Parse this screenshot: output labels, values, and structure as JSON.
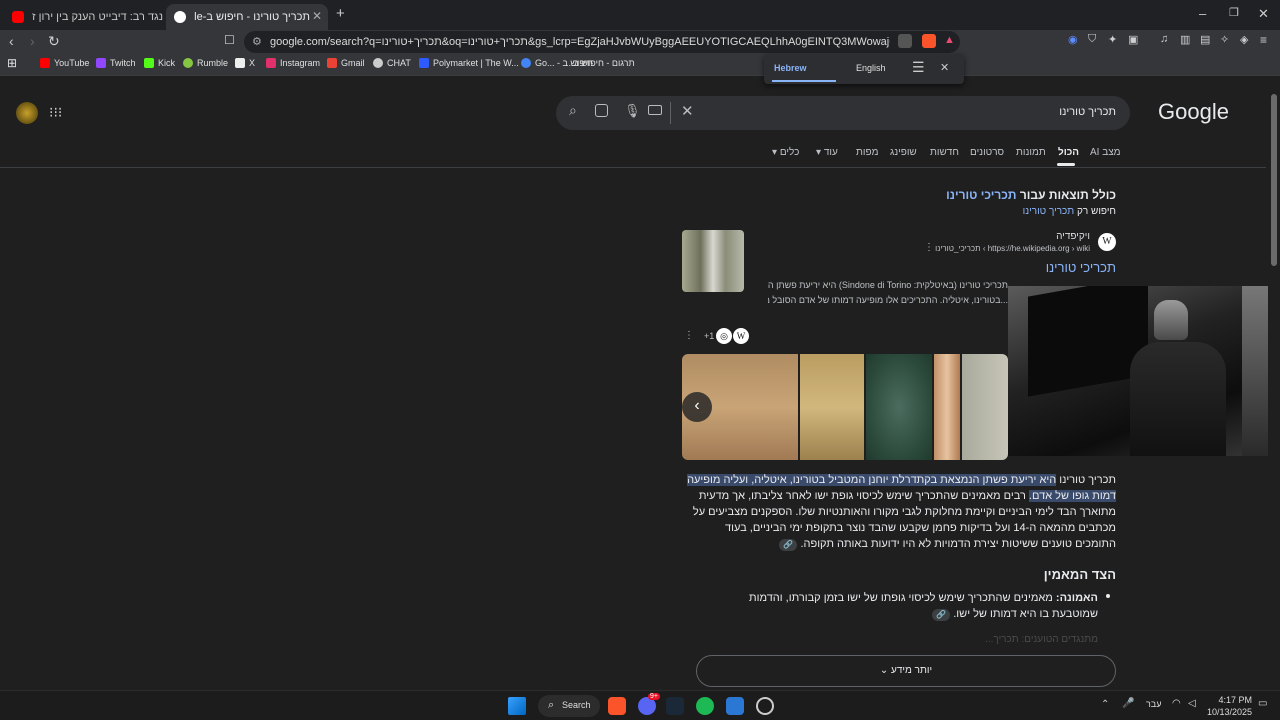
{
  "browser": {
    "tabs": [
      {
        "title": "אתאיסט נגד רב: דיבייט הענק בין ירון ז"
      },
      {
        "title": "תכריך טורינו - חיפוש ב-Google"
      }
    ],
    "new_tab_symbol": "+",
    "url": "google.com/search?q=תכריך+טורינו&oq=תכריך+טורינו&gs_lcrp=EgZjaHJvbWUyBggAEEUYOTIGCAEQLhhA0gEINTQ3MWowajGoAgCwAgA&sourcei...",
    "bookmarks": [
      {
        "label": "YouTube",
        "color": "#ff0000"
      },
      {
        "label": "Twitch",
        "color": "#9146ff"
      },
      {
        "label": "Kick",
        "color": "#53fc18"
      },
      {
        "label": "Rumble",
        "color": "#85c742"
      },
      {
        "label": "X",
        "color": "#ffffff"
      },
      {
        "label": "Instagram",
        "color": "#e1306c"
      },
      {
        "label": "Gmail",
        "color": "#ea4335"
      },
      {
        "label": "CHAT",
        "color": "#cccccc"
      },
      {
        "label": "Polymarket | The W...",
        "color": "#2d5bff"
      },
      {
        "label": "Go... - חיפוש ב",
        "color": "#4285f4"
      },
      {
        "label": "תרגום - חיפוש ב..."
      }
    ]
  },
  "translate_bar": {
    "from": "Hebrew",
    "to": "English"
  },
  "google": {
    "logo": "Google",
    "query": "תכריך טורינו",
    "tabs": [
      "מצב AI",
      "הכול",
      "תמונות",
      "סרטונים",
      "חדשות",
      "שופינג",
      "מפות",
      "עוד",
      "כלים"
    ],
    "selected_tab": "הכול",
    "correction_prefix": "כולל תוצאות עבור",
    "correction_term": "תכריכי טורינו",
    "exact_prefix": "חיפוש רק",
    "exact_term": "תכריך טורינו",
    "result": {
      "site": "ויקיפדיה",
      "breadcrumb": "https://he.wikipedia.org › wiki › תכריכי_טורינו",
      "title": "תכריכי טורינו",
      "snippet_line1": "תכריכי טורינו (באיטלקית: Sindone di Torino) היא יריעת פשתן הנמצאת בקתדרלת יוחנן המטביל",
      "snippet_line2": "...בטורינו, איטליה. התכריכים אלו מופיעה דמותו של אדם הסובל מפגיעות"
    },
    "more_sources": "+1",
    "overview": {
      "lead": "תכריך טורינו",
      "highlight": "היא יריעת פשתן הנמצאת בקתדרלת יוחנן המטביל בטורינו, איטליה, ועליה מופיעה דמות גופו של אדם.",
      "rest": "רבים מאמינים שהתכריך שימש לכיסוי גופת ישו לאחר צליבתו, אך מדעית מתוארך הבד לימי הביניים וקיימת מחלוקת לגבי מקורו והאותנטיות שלו. הספקנים מצביעים על מכתבים מהמאה ה-14 ועל בדיקות פחמן שקבעו שהבד נוצר בתקופת ימי הביניים, בעוד התומכים טוענים ששיטות יצירת הדמויות לא היו ידועות באותה תקופה.",
      "section": "הצד המאמין",
      "bullet_label": "האמונה:",
      "bullet_text": "מאמינים שהתכריך שימש לכיסוי גופתו של ישו בזמן קבורתו, והדמות שמוטבעת בו היא דמותו של ישו.",
      "faded": "מתנגדים הטוענים: תכריך..."
    },
    "more_button": "יותר מידע"
  },
  "taskbar": {
    "search_label": "Search",
    "lang": "עבר",
    "time": "4:17 PM",
    "date": "10/13/2025",
    "discord_badge": "9+"
  },
  "colors": {
    "bg": "#1f1f1f",
    "link": "#8ab4f8",
    "highlight": "#3a4a6b"
  }
}
